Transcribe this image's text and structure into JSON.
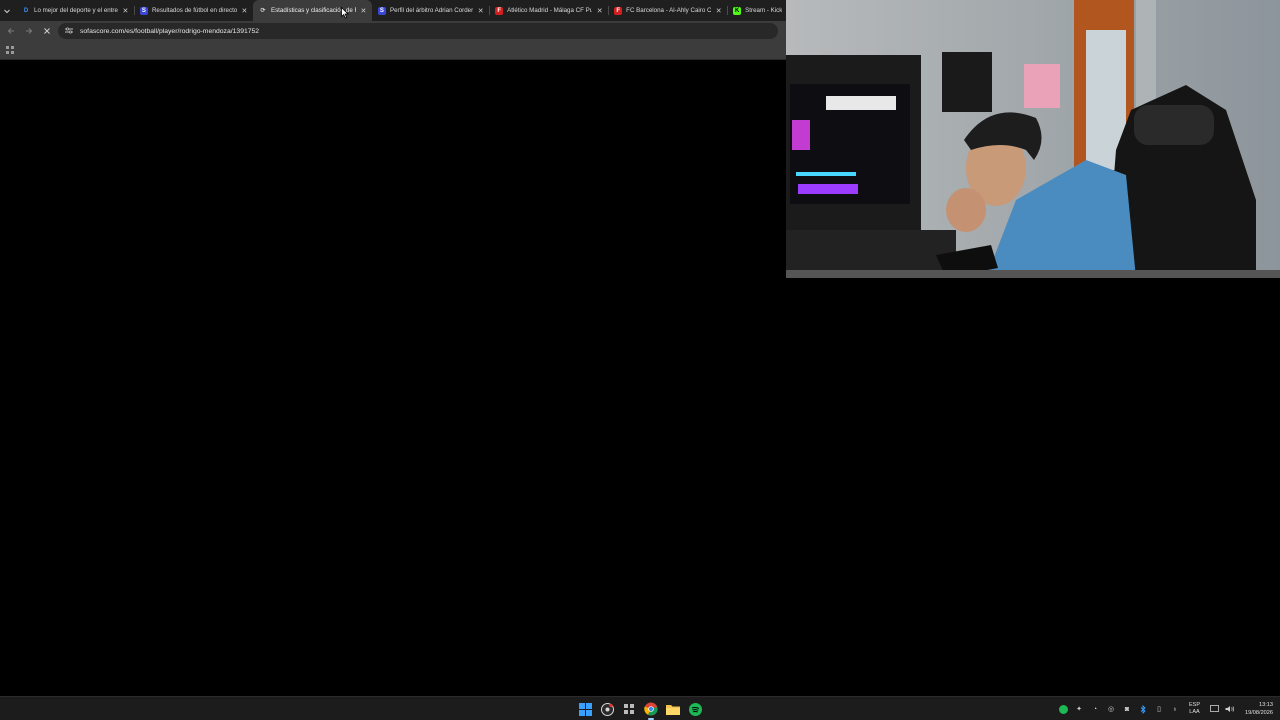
{
  "browser": {
    "tab_search_icon": "chevron-down-icon",
    "tabs": [
      {
        "title": "Lo mejor del deporte y el entre",
        "favicon": "D",
        "favicon_color": "#1f6fd1",
        "active": false
      },
      {
        "title": "Resultados de fútbol en directo",
        "favicon": "S",
        "favicon_color": "#3a47d5",
        "active": false
      },
      {
        "title": "Estadísticas y clasificación de R",
        "favicon": "⟳",
        "favicon_color": "#3c3c3c",
        "active": true
      },
      {
        "title": "Perfil del árbitro Adrian Corder",
        "favicon": "S",
        "favicon_color": "#3a47d5",
        "active": false
      },
      {
        "title": "Atlético Madrid - Málaga CF Pu",
        "favicon": "F",
        "favicon_color": "#d11f1f",
        "active": false
      },
      {
        "title": "FC Barcelona - Al-Ahly Cairo C",
        "favicon": "F",
        "favicon_color": "#d11f1f",
        "active": false
      },
      {
        "title": "Stream - Kick",
        "favicon": "K",
        "favicon_color": "#53fc18",
        "active": false
      }
    ],
    "url": "sofascore.com/es/football/player/rodrigo-mendoza/1391752"
  },
  "taskbar": {
    "language": "ESP",
    "keyboard": "LAA",
    "time": "13:13",
    "date": "19/08/2026"
  },
  "colors": {
    "chrome_dark": "#1f1f1f",
    "chrome_mid": "#3c3c3c",
    "spotify_green": "#1db954",
    "windows_blue": "#2f8ce8"
  }
}
